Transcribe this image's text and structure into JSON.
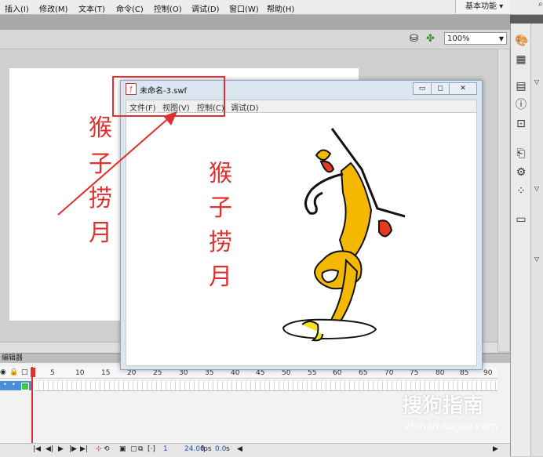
{
  "menubar": {
    "items": [
      "插入(I)",
      "修改(M)",
      "文本(T)",
      "命令(C)",
      "控制(O)",
      "调试(D)",
      "窗口(W)",
      "帮助(H)"
    ],
    "workspace": "基本功能"
  },
  "toolbar": {
    "zoom": "100%"
  },
  "swf_window": {
    "title": "未命名-3.swf",
    "menu": [
      "文件(F)",
      "视图(V)",
      "控制(C)",
      "调试(D)"
    ]
  },
  "annotation": {
    "outer_text": [
      "猴",
      "子",
      "捞",
      "月"
    ],
    "inner_text": [
      "猴",
      "子",
      "捞",
      "月"
    ]
  },
  "timeline": {
    "panel_label": "编辑器",
    "ruler": [
      "1",
      "5",
      "10",
      "15",
      "20",
      "25",
      "30",
      "35",
      "40",
      "45",
      "50",
      "55",
      "60",
      "65",
      "70",
      "75",
      "80",
      "85",
      "90"
    ],
    "footer": {
      "frame": "1",
      "fps": "24.00",
      "fps_unit": "fps",
      "time": "0.0",
      "time_unit": "s"
    }
  },
  "watermark": {
    "brand": "搜狗指南",
    "url": "zhinan.sogou.com"
  },
  "colors": {
    "accent_red": "#e0302f",
    "monkey_yellow": "#f5b800",
    "layer_blue": "#4a8fd8"
  }
}
